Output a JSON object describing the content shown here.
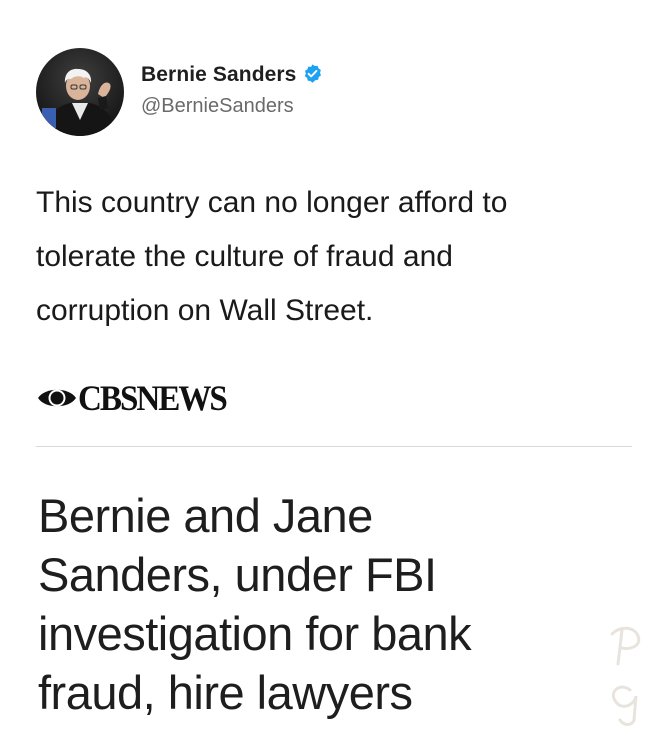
{
  "tweet": {
    "author": {
      "display_name": "Bernie Sanders",
      "handle": "@BernieSanders",
      "verified": true,
      "avatar_icon": "profile-photo"
    },
    "text_lines": [
      "This country can no longer afford to",
      "tolerate the culture of fraud and",
      "corruption on Wall Street."
    ]
  },
  "news_card": {
    "source_logo_text": "CBSNEWS",
    "source_logo_icon": "cbs-eye-icon",
    "headline_lines": [
      "Bernie and Jane",
      "Sanders, under FBI",
      "investigation for bank",
      "fraud, hire lawyers"
    ]
  },
  "colors": {
    "verified_blue": "#1da1f2",
    "text_dark": "#1a1a1a",
    "handle_gray": "#6a6a6a",
    "divider": "#d9d9d9"
  }
}
